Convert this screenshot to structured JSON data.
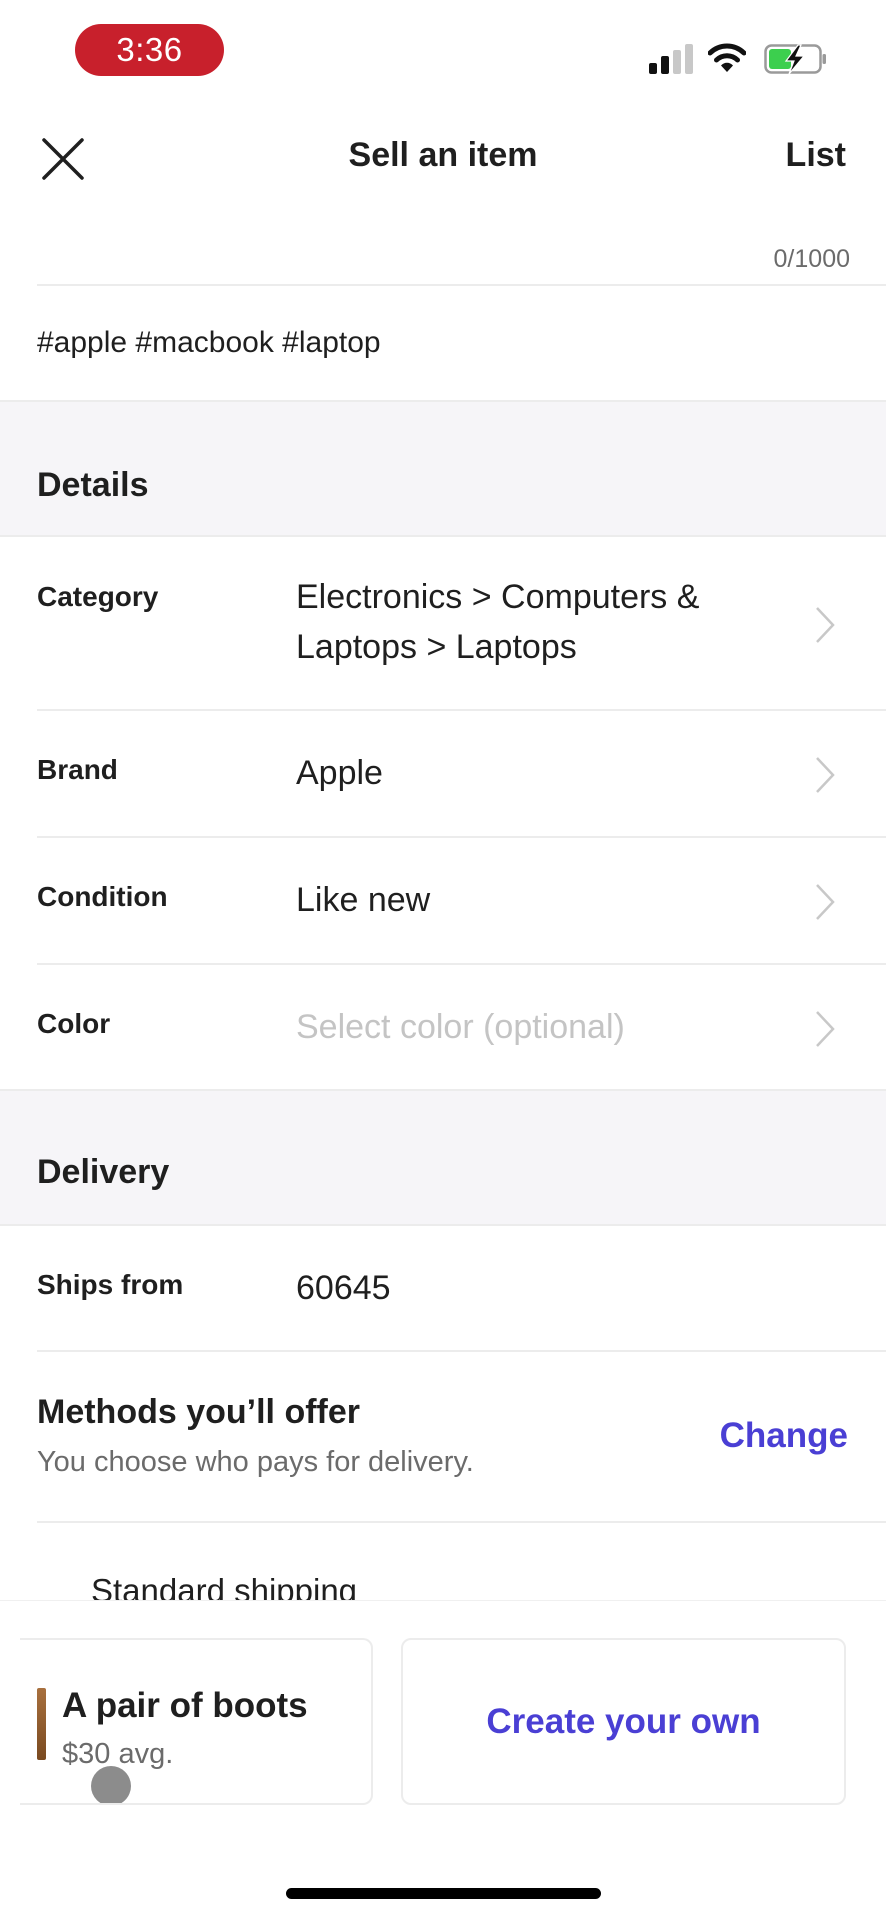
{
  "status_bar": {
    "time": "3:36",
    "signal_icon": "cellular-signal-icon",
    "wifi_icon": "wifi-icon",
    "battery_icon": "battery-charging-icon",
    "colors": {
      "time_pill": "#c8202c",
      "battery_fill": "#3ccf4e"
    }
  },
  "header": {
    "close_icon": "close-icon",
    "title": "Sell an item",
    "list_label": "List"
  },
  "description": {
    "char_counter": "0/1000",
    "hashtags": "#apple #macbook #laptop"
  },
  "details": {
    "section_title": "Details",
    "rows": [
      {
        "label": "Category",
        "value": "Electronics > Computers & Laptops > Laptops",
        "placeholder": false
      },
      {
        "label": "Brand",
        "value": "Apple",
        "placeholder": false
      },
      {
        "label": "Condition",
        "value": "Like new",
        "placeholder": false
      },
      {
        "label": "Color",
        "value": "Select color (optional)",
        "placeholder": true
      }
    ]
  },
  "delivery": {
    "section_title": "Delivery",
    "ships_from_label": "Ships from",
    "ships_from_value": "60645",
    "methods_title": "Methods you’ll offer",
    "methods_subtitle": "You choose who pays for delivery.",
    "change_label": "Change",
    "standard_shipping_label": "Standard shipping"
  },
  "suggestions": {
    "cards": [
      {
        "title": "A pair of boots",
        "subtitle": "$30 avg."
      }
    ],
    "create_own_label": "Create your own"
  },
  "accent_color": "#4a3fd4"
}
